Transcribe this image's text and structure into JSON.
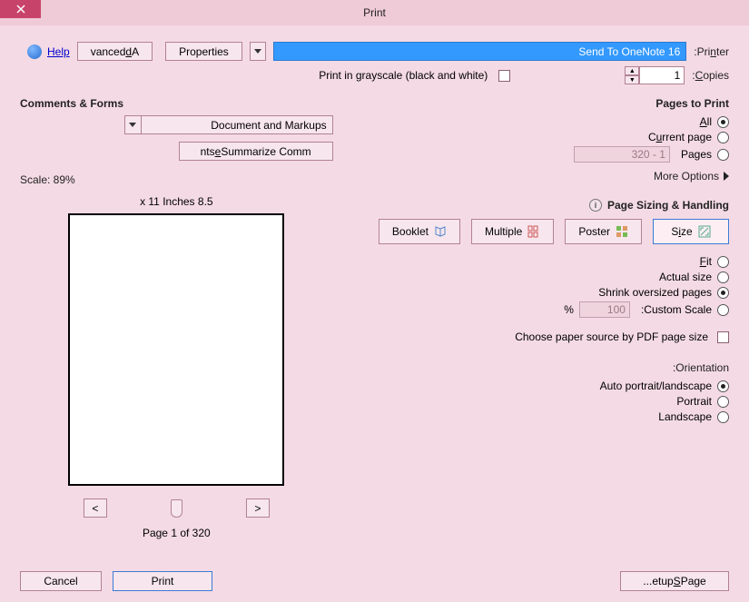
{
  "title": "Print",
  "help": "Help",
  "printer": {
    "label": "Printer:",
    "value": "Send To OneNote 16",
    "properties": "Properties",
    "advanced": "Advanced"
  },
  "copies": {
    "label": "Copies:",
    "value": "1"
  },
  "grayscale_label": "Print in grayscale (black and white)",
  "pages_to_print": {
    "heading": "Pages to Print",
    "all": "All",
    "current": "Current page",
    "pages": "Pages",
    "pages_value": "1 - 320",
    "more": "More Options"
  },
  "sizing": {
    "heading": "Page Sizing & Handling",
    "size": "Size",
    "poster": "Poster",
    "multiple": "Multiple",
    "booklet": "Booklet",
    "fit": "Fit",
    "actual": "Actual size",
    "shrink": "Shrink oversized pages",
    "custom": "Custom Scale:",
    "custom_value": "100",
    "percent": "%",
    "choose_paper": "Choose paper source by PDF page size"
  },
  "orientation": {
    "heading": "Orientation:",
    "auto": "Auto portrait/landscape",
    "portrait": "Portrait",
    "landscape": "Landscape"
  },
  "comments": {
    "heading": "Comments & Forms",
    "value": "Document and Markups",
    "summarize": "Summarize Comments"
  },
  "preview": {
    "scale": "Scale:  89%",
    "dims": "8.5 x 11 Inches",
    "page_of": "Page 1 of 320",
    "prev": "<",
    "next": ">"
  },
  "footer": {
    "setup": "Page Setup...",
    "print": "Print",
    "cancel": "Cancel"
  }
}
